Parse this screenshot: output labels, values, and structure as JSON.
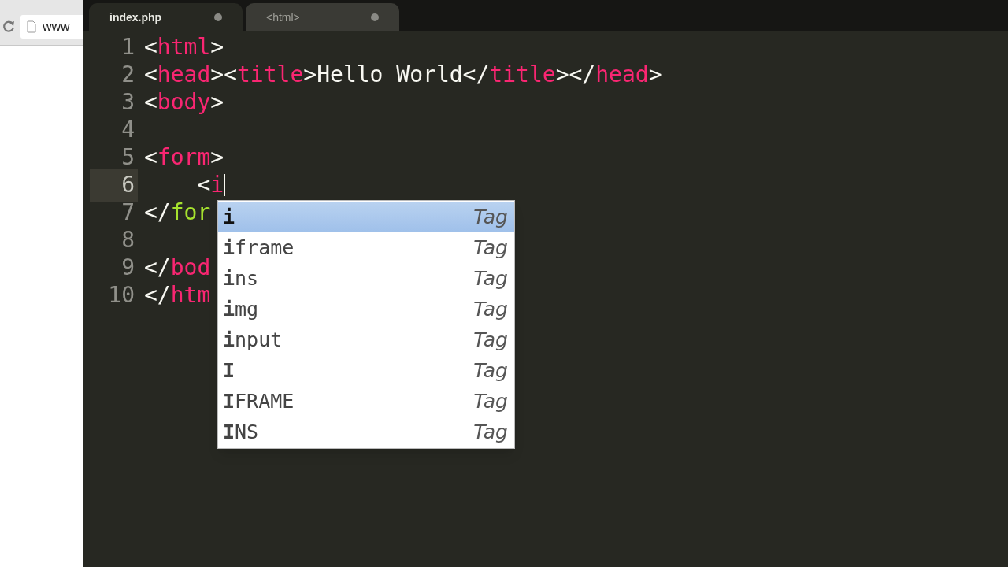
{
  "browser": {
    "address": "www"
  },
  "tabs": [
    {
      "label": "index.php",
      "selected": true
    },
    {
      "label": "<html>",
      "selected": false
    }
  ],
  "lines": [
    {
      "number": "1",
      "current": false,
      "tokens": [
        {
          "kind": "punct",
          "text": "<"
        },
        {
          "kind": "tag",
          "text": "html"
        },
        {
          "kind": "punct",
          "text": ">"
        }
      ]
    },
    {
      "number": "2",
      "current": false,
      "tokens": [
        {
          "kind": "punct",
          "text": "<"
        },
        {
          "kind": "tag",
          "text": "head"
        },
        {
          "kind": "punct",
          "text": "><"
        },
        {
          "kind": "tag",
          "text": "title"
        },
        {
          "kind": "punct",
          "text": ">Hello World</"
        },
        {
          "kind": "tag",
          "text": "title"
        },
        {
          "kind": "punct",
          "text": "></"
        },
        {
          "kind": "tag",
          "text": "head"
        },
        {
          "kind": "punct",
          "text": ">"
        }
      ]
    },
    {
      "number": "3",
      "current": false,
      "tokens": [
        {
          "kind": "punct",
          "text": "<"
        },
        {
          "kind": "tag",
          "text": "body"
        },
        {
          "kind": "punct",
          "text": ">"
        }
      ]
    },
    {
      "number": "4",
      "current": false
    },
    {
      "number": "5",
      "current": false,
      "tokens": [
        {
          "kind": "punct",
          "text": "<"
        },
        {
          "kind": "tag",
          "text": "form"
        },
        {
          "kind": "punct",
          "text": ">"
        }
      ]
    },
    {
      "number": "6",
      "current": true,
      "tokens": [
        {
          "kind": "punct",
          "text": "    <"
        },
        {
          "kind": "tag",
          "text": "i"
        }
      ]
    },
    {
      "number": "7",
      "current": false,
      "tokens": [
        {
          "kind": "punct",
          "text": "</"
        },
        {
          "kind": "attr",
          "text": "for"
        }
      ]
    },
    {
      "number": "8",
      "current": false
    },
    {
      "number": "9",
      "current": false,
      "tokens": [
        {
          "kind": "punct",
          "text": "</"
        },
        {
          "kind": "tag",
          "text": "bod"
        }
      ]
    },
    {
      "number": "10",
      "current": false,
      "tokens": [
        {
          "kind": "punct",
          "text": "</"
        },
        {
          "kind": "tag",
          "text": "htm"
        }
      ]
    }
  ],
  "completions": [
    {
      "match": "**i**",
      "type": "Tag",
      "selected": true
    },
    {
      "match": "**i**frame",
      "type": "Tag",
      "selected": false
    },
    {
      "match": "**i**ns",
      "type": "Tag",
      "selected": false
    },
    {
      "match": "**i**mg",
      "type": "Tag",
      "selected": false
    },
    {
      "match": "**i**nput",
      "type": "Tag",
      "selected": false
    },
    {
      "match": "**I**",
      "type": "Tag",
      "selected": false
    },
    {
      "match": "**I**FRAME",
      "type": "Tag",
      "selected": false
    },
    {
      "match": "**I**NS",
      "type": "Tag",
      "selected": false
    }
  ]
}
